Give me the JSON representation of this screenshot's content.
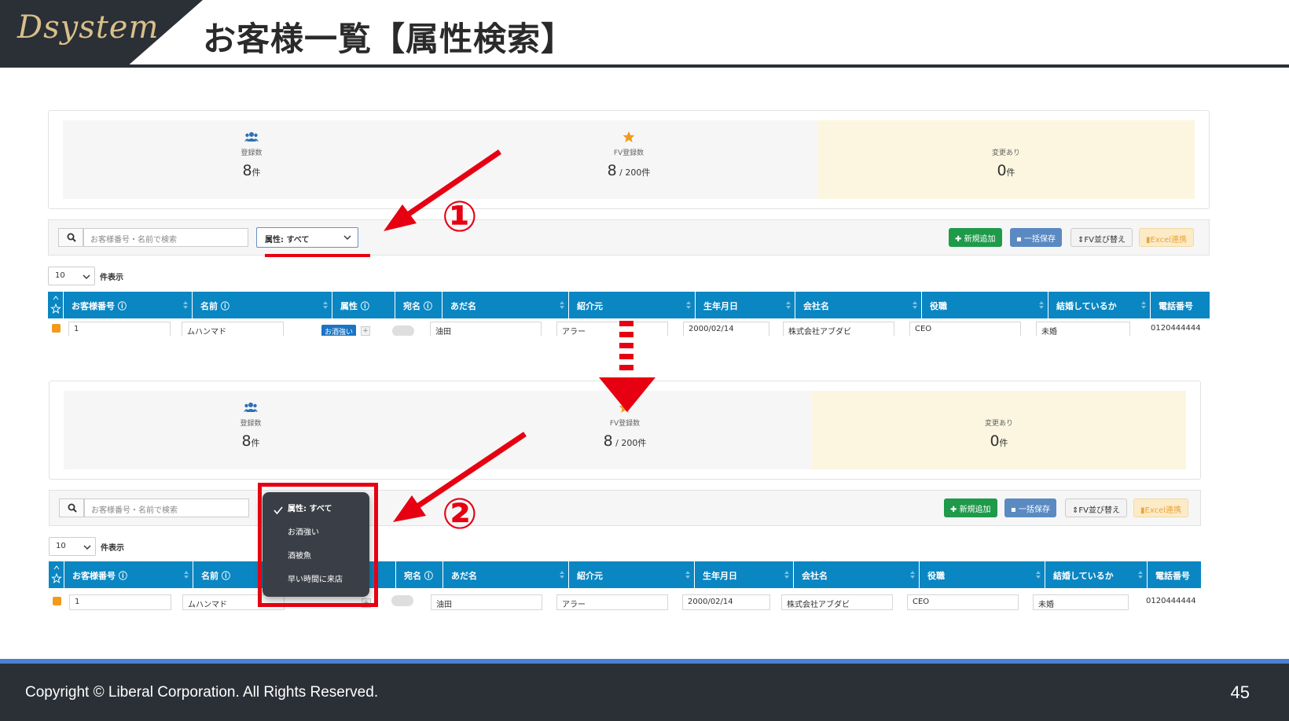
{
  "slide": {
    "logo": "Dsystem",
    "title": "お客様一覧【属性検索】",
    "copyright": "Copyright ©  Liberal Corporation. All Rights Reserved.",
    "page_number": "45"
  },
  "stats": {
    "registered_label": "登録数",
    "registered_value": "8",
    "registered_unit": "件",
    "fv_label": "FV登録数",
    "fv_value": "8",
    "fv_total": " / 200件",
    "changed_label": "変更あり",
    "changed_value": "0",
    "changed_unit": "件"
  },
  "toolbar": {
    "search_placeholder": "お客様番号・名前で検索",
    "attribute_filter": "属性: すべて",
    "add_button": "新規追加",
    "bulk_save_button": "一括保存",
    "fv_sort_button": "FV並び替え",
    "excel_button": "Excel連携"
  },
  "pager": {
    "page_size": "10",
    "page_size_label": "件表示"
  },
  "grid": {
    "headers": [
      "お客様番号",
      "名前",
      "属性",
      "宛名",
      "あだ名",
      "紹介元",
      "生年月日",
      "会社名",
      "役職",
      "結婚しているか",
      "電話番号"
    ],
    "row": {
      "customer_no": "1",
      "name": "ムハンマド",
      "attribute_tag": "お酒強い",
      "nickname": "油田",
      "referrer": "アラー",
      "birthday": "2000/02/14",
      "company": "株式会社アブダビ",
      "position": "CEO",
      "married": "未婚",
      "phone": "0120444444"
    }
  },
  "dropdown": {
    "options": [
      "属性: すべて",
      "お酒強い",
      "酒被魚",
      "早い時間に来店"
    ],
    "selected": "属性: すべて"
  },
  "annotations": {
    "step1": "①",
    "step2": "②"
  },
  "colors": {
    "header_blue": "#0a86c2",
    "annotation_red": "#e60012",
    "add_green": "#1e9a4a",
    "highlight_yellow": "#fcf6e0"
  }
}
